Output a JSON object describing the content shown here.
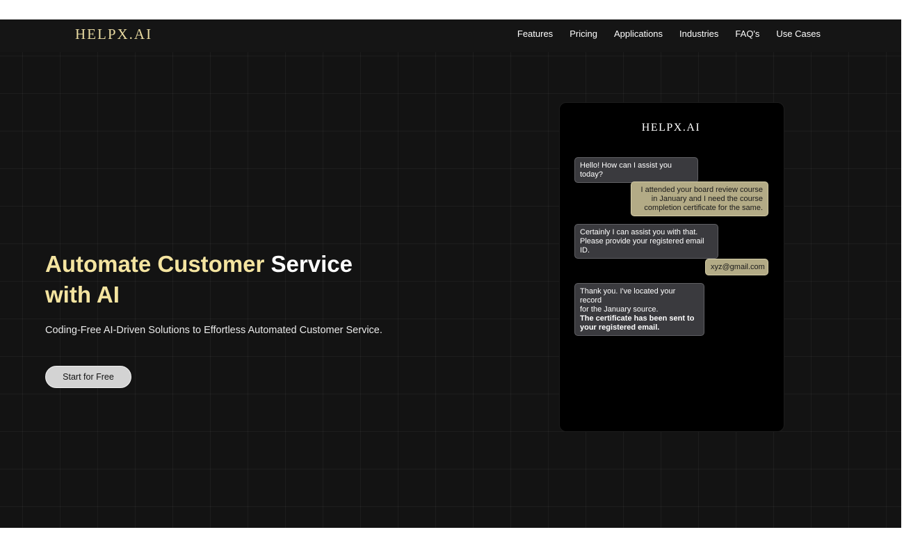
{
  "header": {
    "logo": "HELPX.AI",
    "nav": [
      "Features",
      "Pricing",
      "Applications",
      "Industries",
      "FAQ's",
      "Use Cases"
    ]
  },
  "hero": {
    "title_part1": "Automate Customer",
    "title_part2": "Service",
    "title_part3": "with AI",
    "subtitle": "Coding-Free AI-Driven Solutions to Effortless Automated Customer Service.",
    "cta_label": "Start for Free"
  },
  "chat": {
    "logo": "HELPX.AI",
    "messages": [
      {
        "role": "bot",
        "lines": [
          "Hello! How can I assist you today?"
        ]
      },
      {
        "role": "user",
        "lines": [
          "I attended your board review course",
          "in January and I need the course",
          "completion certificate for the same."
        ]
      },
      {
        "role": "bot",
        "lines": [
          "Certainly I can assist you with that.",
          "Please provide your registered email ID."
        ]
      },
      {
        "role": "user",
        "lines": [
          "xyz@gmail.com"
        ]
      },
      {
        "role": "bot",
        "lines": [
          "Thank you. I've located your record",
          "for the January source."
        ],
        "bold_lines": [
          "The certificate has been sent to",
          "your registered email."
        ]
      }
    ]
  },
  "colors": {
    "background": "#131313",
    "accent_gold": "#f4e4a0",
    "logo_gold": "#e7d9a0",
    "user_bubble": "#b3ab86",
    "bot_bubble": "#3a3a3e",
    "cta_button": "#d3d3d3"
  }
}
